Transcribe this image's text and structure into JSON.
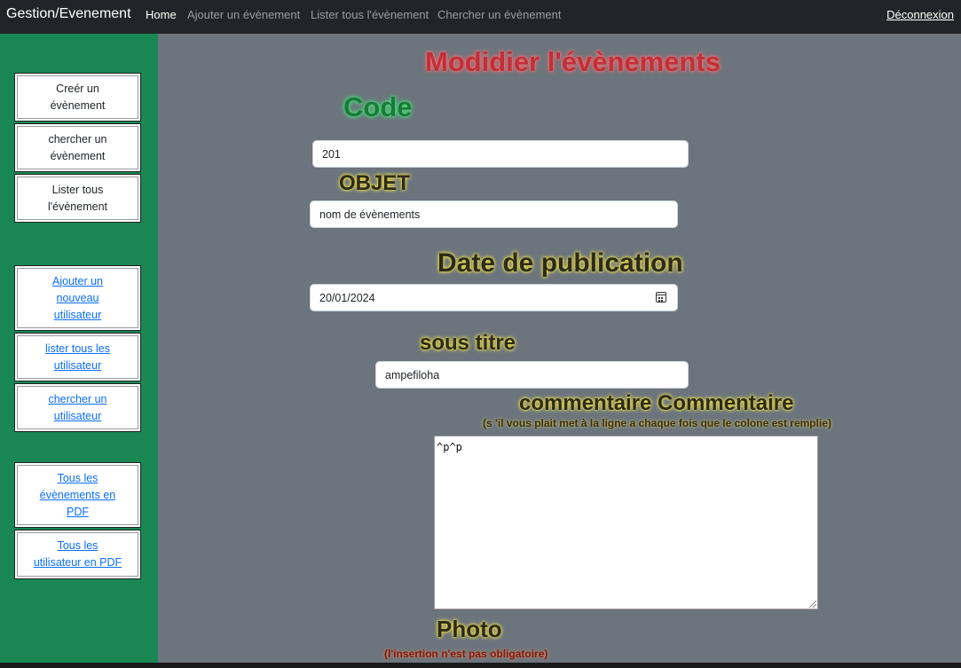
{
  "navbar": {
    "brand": "Gestion/Evenement",
    "items": [
      {
        "label": "Home",
        "active": true
      },
      {
        "label": "Ajouter un évènement",
        "active": false
      },
      {
        "label": "Lister tous l'évènement",
        "active": false
      },
      {
        "label": "Chercher un évènement",
        "active": false
      }
    ],
    "logout": "Déconnexion"
  },
  "sidebar": {
    "group1": [
      "Creér un évènement",
      "chercher un évènement",
      "Lister tous l'évènement"
    ],
    "group2": [
      "Ajouter un nouveau utilisateur",
      "lister tous les utilisateur",
      "chercher un utilisateur"
    ],
    "group3": [
      "Tous les évènements en PDF",
      "Tous les utilisateur en PDF"
    ]
  },
  "form": {
    "title": "Modidier l'évènements",
    "code_label": "Code",
    "code_value": "201",
    "objet_label": "OBJET",
    "objet_value": "nom de évènements",
    "date_label": "Date de publication",
    "date_value": "20/01/2024",
    "soustitre_label": "sous titre",
    "soustitre_value": "ampefiloha",
    "comment_label": "commentaire Commentaire",
    "comment_note": "(s 'il vous plait met à la ligne a chaque fois que le colone est remplie)",
    "comment_value": "^p^p",
    "photo_label": "Photo",
    "photo_note": "(l'insertion n'est pas obligatoire)"
  },
  "colors": {
    "navbar": "#212529",
    "sidebar": "#198754",
    "content": "#6c757d",
    "title_red": "#c0303a",
    "code_green": "#1c7a3a",
    "link": "#0d6efd"
  }
}
